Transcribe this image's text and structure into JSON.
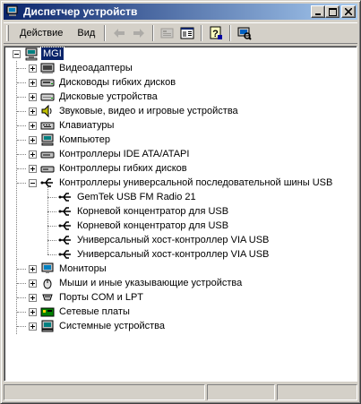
{
  "window": {
    "title": "Диспетчер устройств",
    "minimize_icon": "minimize-icon",
    "maximize_icon": "maximize-icon",
    "close_icon": "close-icon"
  },
  "toolbar": {
    "menu_action": "Действие",
    "menu_view": "Вид",
    "buttons": [
      "back-arrow-icon",
      "forward-arrow-icon",
      "properties-icon",
      "tree-view-icon",
      "help-icon",
      "scan-hardware-icon"
    ]
  },
  "tree": {
    "root": "MGI",
    "categories": [
      "Видеоадаптеры",
      "Дисководы гибких дисков",
      "Дисковые устройства",
      "Звуковые, видео и игровые устройства",
      "Клавиатуры",
      "Компьютер",
      "Контроллеры IDE ATA/ATAPI",
      "Контроллеры гибких дисков",
      "Контроллеры универсальной последовательной шины USB",
      "Мониторы",
      "Мыши и иные указывающие устройства",
      "Порты COM и LPT",
      "Сетевые платы",
      "Системные устройства"
    ],
    "usb_children": [
      "GemTek USB FM Radio 21",
      "Корневой концентратор для USB",
      "Корневой концентратор для USB",
      "Универсальный хост-контроллер VIA USB",
      "Универсальный хост-контроллер VIA USB"
    ]
  },
  "colors": {
    "titlebar_start": "#0a246a",
    "titlebar_end": "#a6caf0",
    "selection": "#0a246a",
    "face": "#d4d0c8"
  }
}
